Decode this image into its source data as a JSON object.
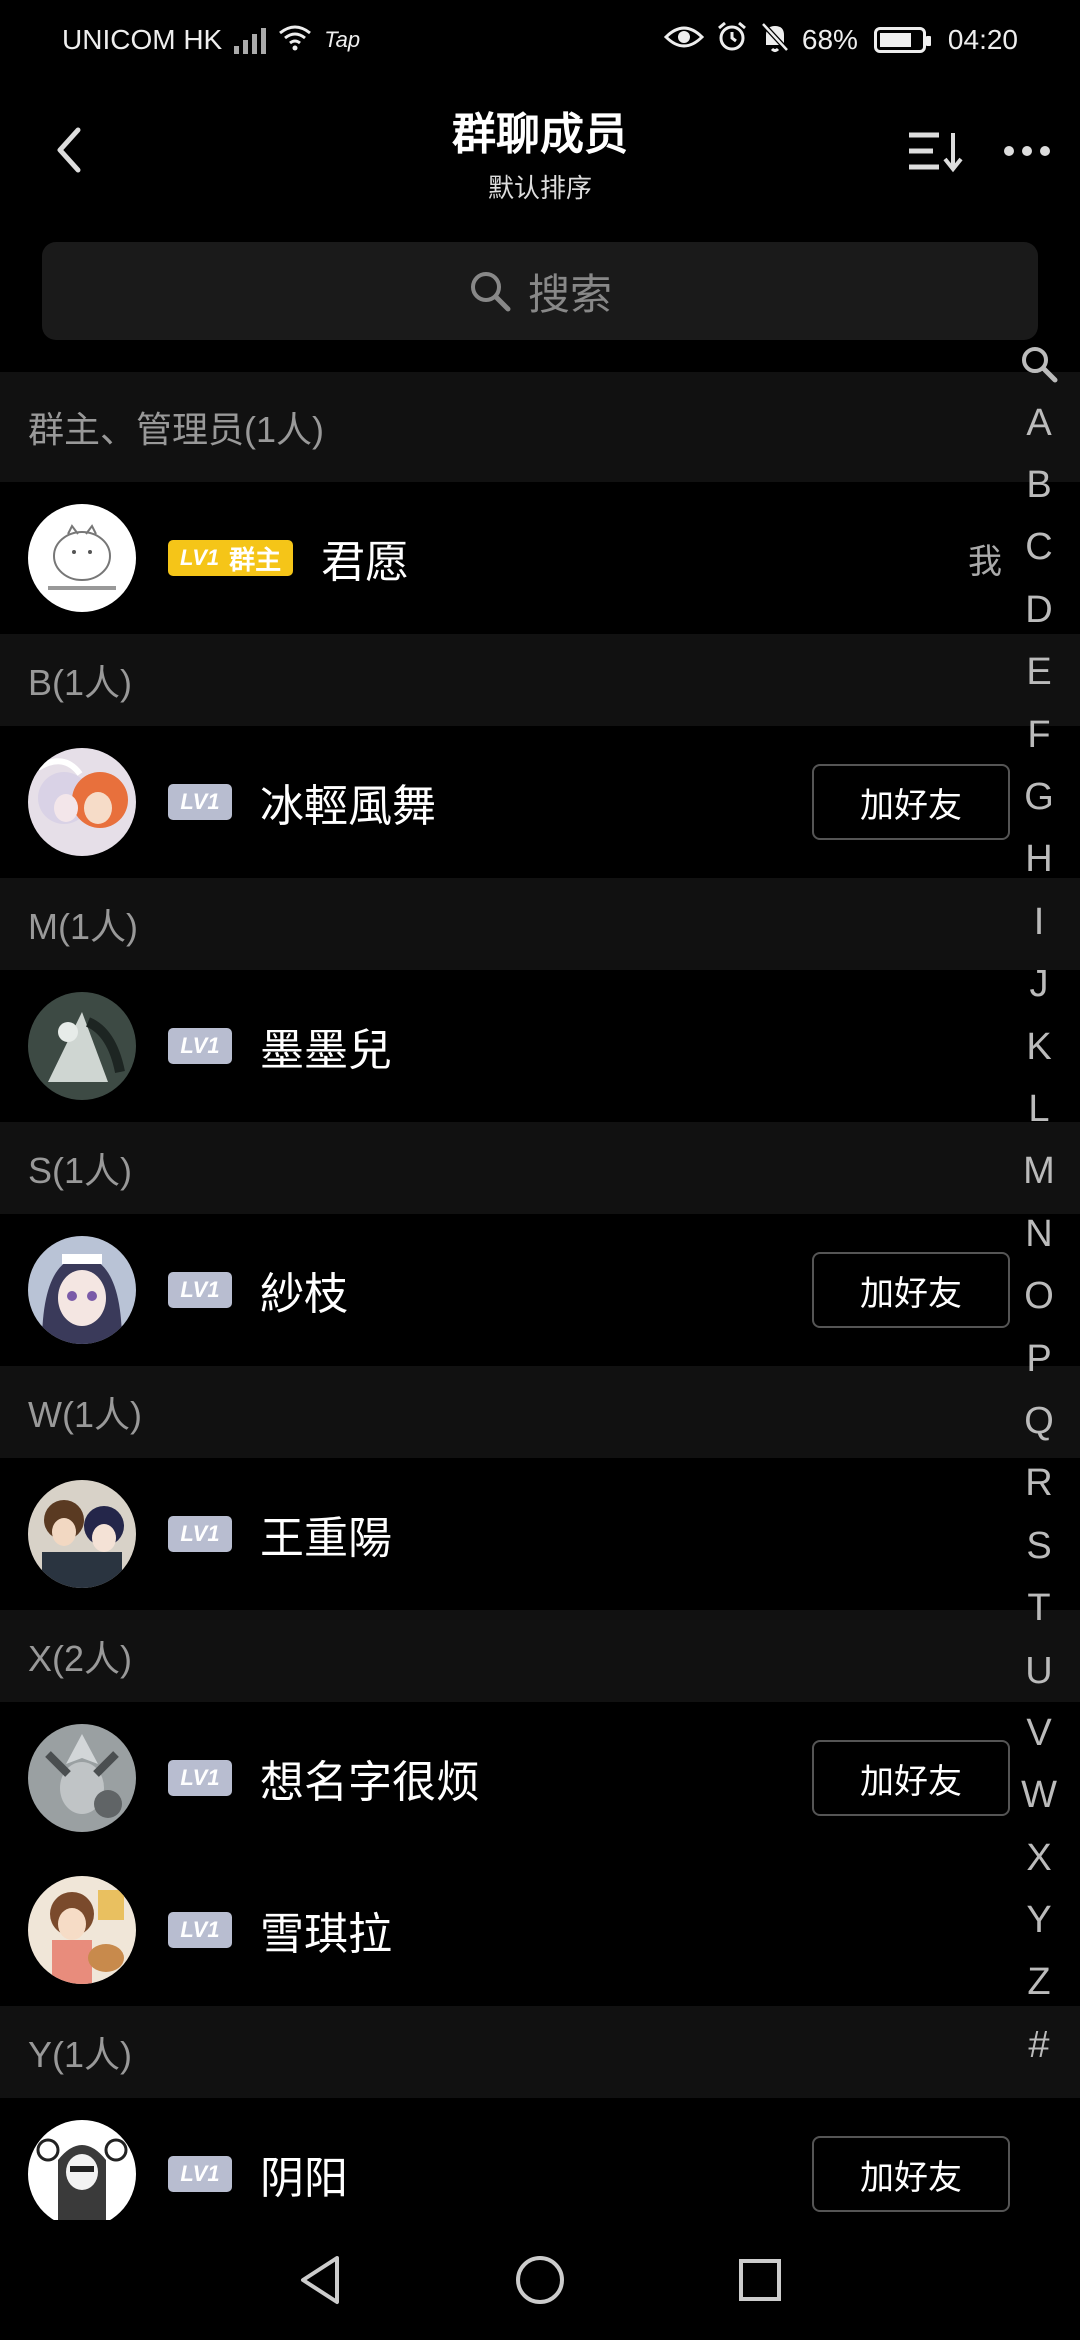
{
  "status": {
    "carrier": "UNICOM HK",
    "tap": "Tap",
    "battery": "68%",
    "battery_level": 0.68,
    "time": "04:20"
  },
  "header": {
    "title": "群聊成员",
    "subtitle": "默认排序"
  },
  "search": {
    "placeholder": "搜索"
  },
  "sections": {
    "admins": "群主、管理员(1人)",
    "b": "B(1人)",
    "m": "M(1人)",
    "s": "S(1人)",
    "w": "W(1人)",
    "x": "X(2人)",
    "y": "Y(1人)"
  },
  "members": [
    {
      "name": "君愿",
      "level": "LV1",
      "role": "群主",
      "me": "我"
    },
    {
      "name": "冰輕風舞",
      "level": "LV1",
      "action": "加好友"
    },
    {
      "name": "墨墨兒",
      "level": "LV1"
    },
    {
      "name": "紗枝",
      "level": "LV1",
      "action": "加好友"
    },
    {
      "name": "王重陽",
      "level": "LV1"
    },
    {
      "name": "想名字很烦",
      "level": "LV1",
      "action": "加好友"
    },
    {
      "name": "雪琪拉",
      "level": "LV1"
    },
    {
      "name": "阴阳",
      "level": "LV1",
      "action": "加好友"
    }
  ],
  "index": [
    "A",
    "B",
    "C",
    "D",
    "E",
    "F",
    "G",
    "H",
    "I",
    "J",
    "K",
    "L",
    "M",
    "N",
    "O",
    "P",
    "Q",
    "R",
    "S",
    "T",
    "U",
    "V",
    "W",
    "X",
    "Y",
    "Z",
    "#"
  ],
  "colors": {
    "background": "#000000",
    "section_bg": "#111111",
    "owner_badge": "#f5c518",
    "level_badge": "#b8bdd0"
  }
}
